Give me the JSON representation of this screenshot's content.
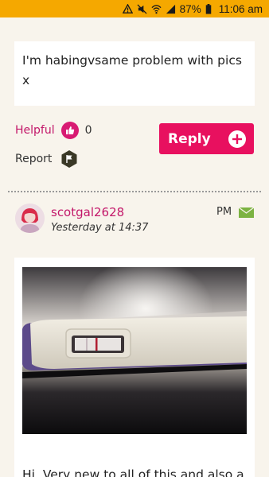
{
  "status_bar": {
    "battery_percent": "87%",
    "time": "11:06 am",
    "bg_color": "#f5a800"
  },
  "post": {
    "text": "I'm habingvsame problem with pics x"
  },
  "actions": {
    "helpful_label": "Helpful",
    "helpful_count": "0",
    "report_label": "Report",
    "reply_label": "Reply",
    "accent_color": "#e8105f"
  },
  "reply_post": {
    "username": "scotgal2628",
    "time": "Yesterday at 14:37",
    "pm_label": "PM",
    "body_text": "Hi. Very new to all of this and also a"
  },
  "icons": {
    "like": "thumbs-up-icon",
    "report": "flag-icon",
    "reply": "plus-icon",
    "pm": "mail-icon"
  }
}
